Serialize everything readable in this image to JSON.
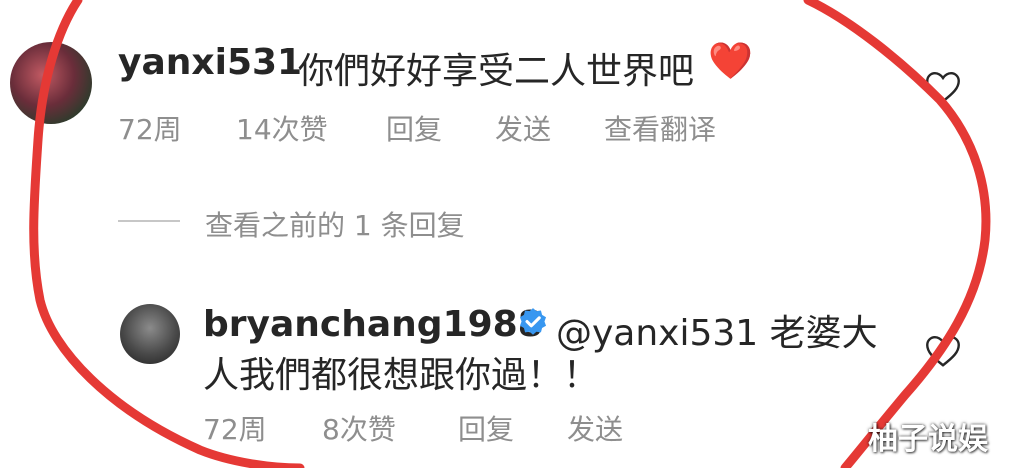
{
  "comment_1": {
    "username": "yanxi531",
    "text": "你們好好享受二人世界吧",
    "emoji": "❤️",
    "time": "72周",
    "likes": "14次赞",
    "reply_label": "回复",
    "send_label": "发送",
    "translate_label": "查看翻译"
  },
  "replies_toggle": {
    "label": "查看之前的 1 条回复"
  },
  "comment_2": {
    "username": "bryanchang1988",
    "text_line_1": "@yanxi531 老婆大",
    "text_line_2": "人我們都很想跟你過！！",
    "time": "72周",
    "likes": "8次赞",
    "reply_label": "回复",
    "send_label": "发送"
  },
  "watermark": {
    "text": "柚子说娱"
  },
  "colors": {
    "text": "#262626",
    "meta": "#8e8e8e",
    "verified_blue": "#3897f0",
    "annotation_red": "#e53935",
    "heart_red": "#e0242b"
  },
  "icons": {
    "like": "heart-outline-icon",
    "verified": "verified-badge-icon"
  }
}
